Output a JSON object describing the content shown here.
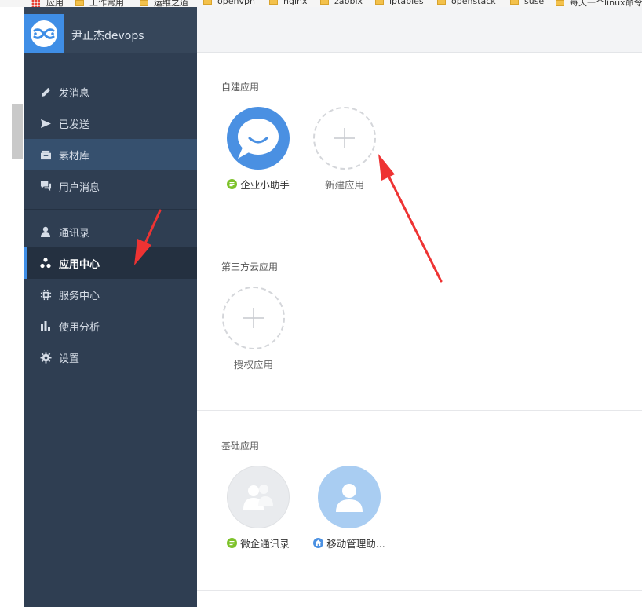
{
  "bookmarks": {
    "items": [
      {
        "label": "应用",
        "icon": "apps-grid-icon"
      },
      {
        "label": "工作常用",
        "icon": "folder-icon"
      },
      {
        "label": "运维之道",
        "icon": "folder-icon"
      },
      {
        "label": "openvpn",
        "icon": "folder-icon"
      },
      {
        "label": "nginx",
        "icon": "folder-icon"
      },
      {
        "label": "zabbix",
        "icon": "folder-icon"
      },
      {
        "label": "iptables",
        "icon": "folder-icon"
      },
      {
        "label": "openstack",
        "icon": "folder-icon"
      },
      {
        "label": "suse",
        "icon": "folder-icon"
      },
      {
        "label": "每天一个linux命令",
        "icon": "folder-icon"
      }
    ]
  },
  "sidebar": {
    "brand": "尹正杰devops",
    "items": [
      {
        "label": "发消息",
        "icon": "pencil-icon"
      },
      {
        "label": "已发送",
        "icon": "send-icon"
      },
      {
        "label": "素材库",
        "icon": "archive-icon"
      },
      {
        "label": "用户消息",
        "icon": "chat-icon"
      },
      {
        "label": "通讯录",
        "icon": "person-icon"
      },
      {
        "label": "应用中心",
        "icon": "apps-dots-icon",
        "active": true
      },
      {
        "label": "服务中心",
        "icon": "chip-icon"
      },
      {
        "label": "使用分析",
        "icon": "bar-chart-icon"
      },
      {
        "label": "设置",
        "icon": "gear-icon"
      }
    ]
  },
  "main": {
    "sections": [
      {
        "title": "自建应用",
        "apps": [
          {
            "name": "企业小助手",
            "badge": "green"
          },
          {
            "name": "新建应用",
            "type": "add"
          }
        ]
      },
      {
        "title": "第三方云应用",
        "apps": [
          {
            "name": "授权应用",
            "type": "add"
          }
        ]
      },
      {
        "title": "基础应用",
        "apps": [
          {
            "name": "微企通讯录",
            "badge": "green"
          },
          {
            "name": "移动管理助...",
            "badge": "blue"
          }
        ]
      }
    ]
  },
  "colors": {
    "sidebar": "#2f3e52",
    "accent": "#3f8ee6",
    "badge_green": "#7dc22a",
    "badge_blue": "#4a90e2",
    "annotation_arrow": "#ee3333"
  }
}
